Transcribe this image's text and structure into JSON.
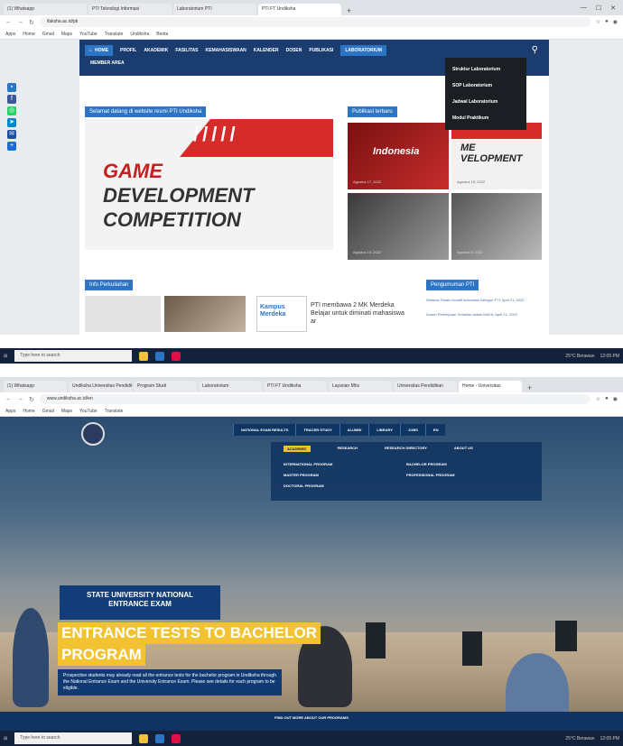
{
  "shot1": {
    "tabs": [
      "(1) Whatsapp",
      "PTI Teknologi Informasi",
      "Laboratorium PTI",
      "PTI FT Undiksha"
    ],
    "url": "ifaksha.ac.id/pti",
    "bookmarks": [
      "Apps",
      "Home",
      "Gmail",
      "Maps",
      "YouTube",
      "Translate",
      "Undiksha",
      "Berita"
    ],
    "nav": [
      "HOME",
      "PROFIL",
      "AKADEMIK",
      "FASILITAS",
      "KEMAHASISWAAN",
      "KALENDER",
      "DOSEN",
      "PUBLIKASI",
      "LABORATORIUM"
    ],
    "nav_row2": "MEMBER AREA",
    "dropdown": [
      "Struktur Laboratorium",
      "SOP Laboratorium",
      "Jadwal Laboratorium",
      "Modul Praktikum"
    ],
    "welcome": "Selamat datang di website resmi PTI Undiksha",
    "publikasi_label": "Publikasi terbaru",
    "hero": {
      "slashes": "/////",
      "line1": "GAME",
      "line2": "DEVELOPMENT",
      "line3": "COMPETITION"
    },
    "tiles": [
      {
        "title": "Indonesia",
        "caption": "Agustus 17, 2022"
      },
      {
        "title": "ME\nVELOPMENT",
        "caption": "Agustus 15, 2022"
      },
      {
        "title": "",
        "caption": "Agustus 10, 2022"
      },
      {
        "title": "",
        "caption": "Agustus 5, 2022"
      }
    ],
    "info_label": "Info Perkuliahan",
    "pengumuman_label": "Pengumuman PTI",
    "kampus": "Kampus Merdeka",
    "news": "PTI membawa 2 MK Merdeka Belajar untuk diminati mahasiswa ar",
    "pengumuman": [
      "Webinar Studio Kreatif Indonesia Kategori PTI: April 21, 2022",
      "Dosen Perempuan Terdaftar dalam MAFA: April 21, 2022"
    ]
  },
  "shot2": {
    "tabs": [
      "(1) Whatsapp",
      "Undiksha Universitas Pendidikan",
      "Program Studi",
      "Laboratorium",
      "PTI FT Undiksha",
      "Layanan Mhs",
      "Universitas Pendidikan",
      "Home - Universitas"
    ],
    "url": "www.undiksha.ac.id/en",
    "topbar": [
      "NATIONAL EXAM RESULTS",
      "TRACER STUDY",
      "ALUMNI",
      "LIBRARY",
      "JOBS",
      "EN"
    ],
    "menu_row1": [
      "ACADEMIC",
      "RESEARCH",
      "RESEARCH DIRECTORY",
      "ABOUT US"
    ],
    "menu_items_left": [
      "INTERNATIONAL PROGRAM",
      "MASTER PROGRAM",
      "DOCTORAL PROGRAM"
    ],
    "menu_items_right": [
      "BACHELOR PROGRAM",
      "PROFESSIONAL PROGRAM"
    ],
    "sunex_line1": "STATE UNIVERSITY NATIONAL",
    "sunex_line2": "ENTRANCE EXAM",
    "heading_line1": "ENTRANCE TESTS TO BACHELOR",
    "heading_line2": "PROGRAM",
    "description": "Prospective students may already read all the entrance tests for the bachelor program in Undiksha through the National Entrance Exam and the University Entrance Exam. Please see details for each program to be eligible.",
    "banner": "FIND OUT MORE ABOUT OUR PROGRAMS"
  },
  "taskbar": {
    "search": "Type here to search",
    "weather": "25°C  Berawan",
    "time": "12:05 PM"
  }
}
